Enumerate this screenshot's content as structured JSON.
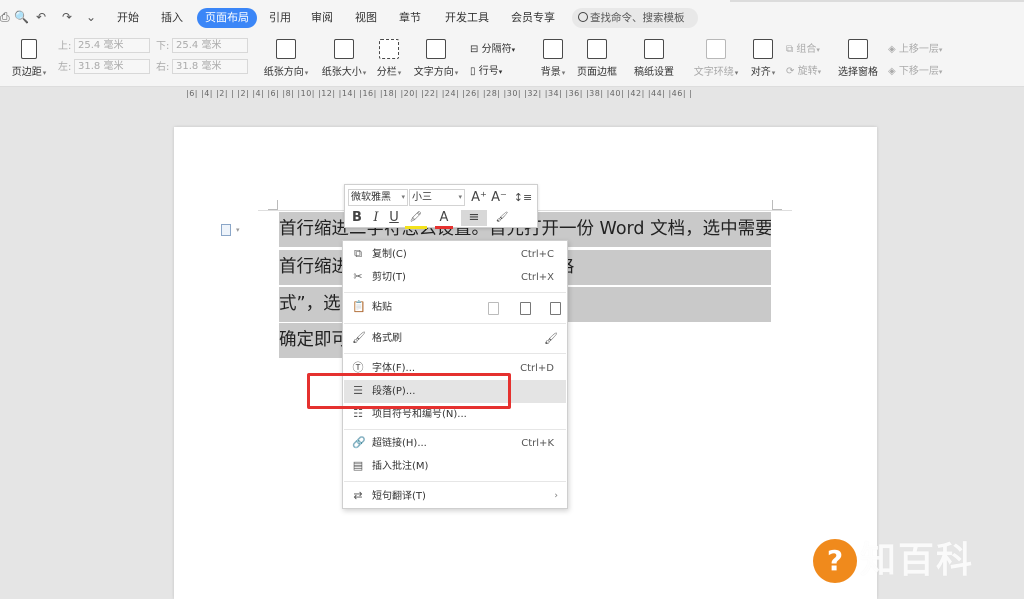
{
  "quick_access": [
    "⎙",
    "🔍",
    "↶",
    "↷",
    "⌄"
  ],
  "tabs": [
    {
      "label": "开始",
      "active": false
    },
    {
      "label": "插入",
      "active": false
    },
    {
      "label": "页面布局",
      "active": true
    },
    {
      "label": "引用",
      "active": false
    },
    {
      "label": "审阅",
      "active": false
    },
    {
      "label": "视图",
      "active": false
    },
    {
      "label": "章节",
      "active": false
    },
    {
      "label": "开发工具",
      "active": false
    },
    {
      "label": "会员专享",
      "active": false
    }
  ],
  "search": {
    "placeholder": "查找命令、搜索模板"
  },
  "ribbon": {
    "margins": {
      "label": "页边距"
    },
    "margin_top": {
      "label": "上:",
      "value": "25.4 毫米"
    },
    "margin_bottom": {
      "label": "下:",
      "value": "25.4 毫米"
    },
    "margin_left": {
      "label": "左:",
      "value": "31.8 毫米"
    },
    "margin_right": {
      "label": "右:",
      "value": "31.8 毫米"
    },
    "orientation": {
      "label": "纸张方向"
    },
    "size": {
      "label": "纸张大小"
    },
    "columns": {
      "label": "分栏"
    },
    "text_direction": {
      "label": "文字方向"
    },
    "breaks": {
      "label": "分隔符"
    },
    "line_numbers": {
      "label": "行号"
    },
    "background": {
      "label": "背景"
    },
    "page_border": {
      "label": "页面边框"
    },
    "manuscript": {
      "label": "稿纸设置"
    },
    "text_wrap": {
      "label": "文字环绕"
    },
    "align": {
      "label": "对齐"
    },
    "group": {
      "label": "组合"
    },
    "rotate": {
      "label": "旋转"
    },
    "selection_pane": {
      "label": "选择窗格"
    },
    "bring_forward": {
      "label": "上移一层"
    },
    "send_backward": {
      "label": "下移一层"
    }
  },
  "ruler_ticks": "|6| |4| |2| |  |2| |4| |6| |8| |10| |12| |14| |16| |18| |20| |22| |24| |26| |28| |30| |32| |34| |36| |38| |40| |42| |44| |46| |",
  "document": {
    "lines": [
      "首行缩进二字符怎么设置。首先打开一份 Word 文档，选中需要",
      "首行缩进                                      “段落”，下拉其中的“特殊格",
      "式”，选                                       值为“2”字符。最后点击",
      "确定即可"
    ]
  },
  "mini_toolbar": {
    "font": "微软雅黑",
    "size": "小三",
    "grow": "A⁺",
    "shrink": "A⁻",
    "spacing": "↕≡",
    "bold": "B",
    "italic": "I",
    "underline": "U",
    "highlight": "🖍",
    "font_color": "A",
    "align": "≡",
    "brush": "🖌"
  },
  "context_menu": {
    "items": [
      {
        "icon": "copy-icon",
        "glyph": "⧉",
        "label": "复制(C)",
        "shortcut": "Ctrl+C"
      },
      {
        "icon": "cut-icon",
        "glyph": "✂",
        "label": "剪切(T)",
        "shortcut": "Ctrl+X"
      },
      {
        "icon": "paste-icon",
        "glyph": "📋",
        "label": "粘贴",
        "shortcut": ""
      },
      {
        "icon": "format-brush-icon",
        "glyph": "🖌",
        "label": "格式刷",
        "shortcut": ""
      },
      {
        "icon": "font-icon",
        "glyph": "Ⓣ",
        "label": "字体(F)...",
        "shortcut": "Ctrl+D"
      },
      {
        "icon": "paragraph-icon",
        "glyph": "☰",
        "label": "段落(P)...",
        "shortcut": ""
      },
      {
        "icon": "list-icon",
        "glyph": "☷",
        "label": "项目符号和编号(N)...",
        "shortcut": ""
      },
      {
        "icon": "hyperlink-icon",
        "glyph": "🔗",
        "label": "超链接(H)...",
        "shortcut": "Ctrl+K"
      },
      {
        "icon": "comment-icon",
        "glyph": "▤",
        "label": "插入批注(M)",
        "shortcut": ""
      },
      {
        "icon": "translate-icon",
        "glyph": "⇄",
        "label": "短句翻译(T)",
        "shortcut": ""
      }
    ],
    "highlighted_index": 5
  },
  "watermark": {
    "symbol": "?",
    "text": "知百科"
  },
  "colors": {
    "accent": "#3b86f7",
    "highlight_box": "#e5312f",
    "selection": "#c9c9c9",
    "watermark": "#f08a1c"
  }
}
